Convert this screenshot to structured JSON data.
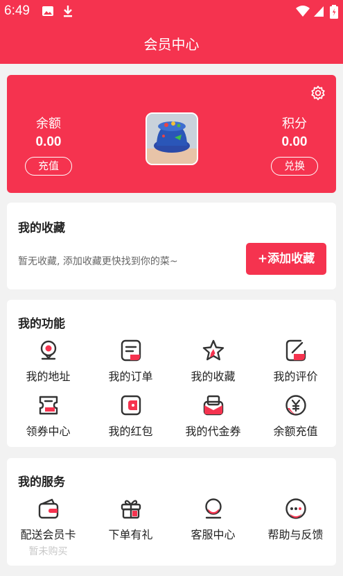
{
  "status_bar": {
    "time": "6:49"
  },
  "header": {
    "title": "会员中心"
  },
  "member_card": {
    "balance_label": "余额",
    "balance_value": "0.00",
    "recharge_label": "充值",
    "points_label": "积分",
    "points_value": "0.00",
    "exchange_label": "兑换"
  },
  "favorites": {
    "title": "我的收藏",
    "empty_text": "暂无收藏, 添加收藏更快找到你的菜~",
    "add_label": "+添加收藏"
  },
  "functions": {
    "title": "我的功能",
    "items": [
      {
        "label": "我的地址",
        "icon": "location-icon"
      },
      {
        "label": "我的订单",
        "icon": "order-icon"
      },
      {
        "label": "我的收藏",
        "icon": "star-icon"
      },
      {
        "label": "我的评价",
        "icon": "review-icon"
      },
      {
        "label": "领券中心",
        "icon": "coupon-icon"
      },
      {
        "label": "我的红包",
        "icon": "red-packet-icon"
      },
      {
        "label": "我的代金券",
        "icon": "voucher-icon"
      },
      {
        "label": "余额充值",
        "icon": "yen-icon"
      }
    ]
  },
  "services": {
    "title": "我的服务",
    "items": [
      {
        "label": "配送会员卡",
        "sub": "暂未购买",
        "icon": "card-icon"
      },
      {
        "label": "下单有礼",
        "icon": "gift-icon"
      },
      {
        "label": "客服中心",
        "icon": "customer-service-icon"
      },
      {
        "label": "帮助与反馈",
        "icon": "chat-icon"
      }
    ]
  },
  "colors": {
    "accent": "#f5334f",
    "background": "#f2f2f2",
    "icon_stroke": "#333333"
  }
}
